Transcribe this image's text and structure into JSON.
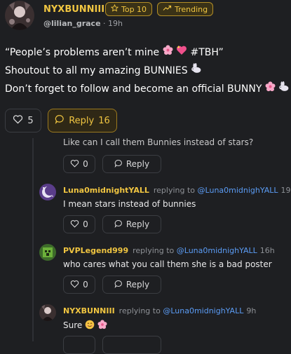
{
  "post": {
    "username": "NYXBUNNIII",
    "badge_top": "Top 10",
    "badge_trending": "Trending",
    "handle": "@lilian_grace",
    "time": "19h",
    "line1": "“People’s problems aren’t mine",
    "line1_tag": "#TBH”",
    "line2": "Shoutout to all my amazing BUNNIES",
    "line3": "Don’t forget to follow and become an official BUNNY",
    "likes": "5",
    "reply_label": "Reply",
    "reply_count": "16"
  },
  "comments": [
    {
      "text": "Like can I call them Bunnies instead of stars?",
      "likes": "0",
      "reply_label": "Reply"
    },
    {
      "name": "Luna0midnightYALL",
      "replying": "replying to",
      "mention": "@Luna0midnighYALL",
      "time": "19h",
      "text": "I mean stars instead of bunnies",
      "likes": "0",
      "reply_label": "Reply"
    },
    {
      "name": "PVPLegend999",
      "replying": "replying to",
      "mention": "@Luna0midnighYALL",
      "time": "16h",
      "text": "who cares what you call them she is a bad poster",
      "likes": "0",
      "reply_label": "Reply"
    },
    {
      "name": "NYXBUNNIII",
      "replying": "replying to",
      "mention": "@Luna0midnighYALL",
      "time": "9h",
      "text": "Sure"
    }
  ],
  "icons": {
    "heart": "heart-icon",
    "reply": "reply-bubble-icon",
    "star": "star-icon",
    "trending": "trending-icon"
  },
  "colors": {
    "background": "#1e1f22",
    "accent_gold": "#f0c541",
    "mention_blue": "#5b9cf5"
  }
}
